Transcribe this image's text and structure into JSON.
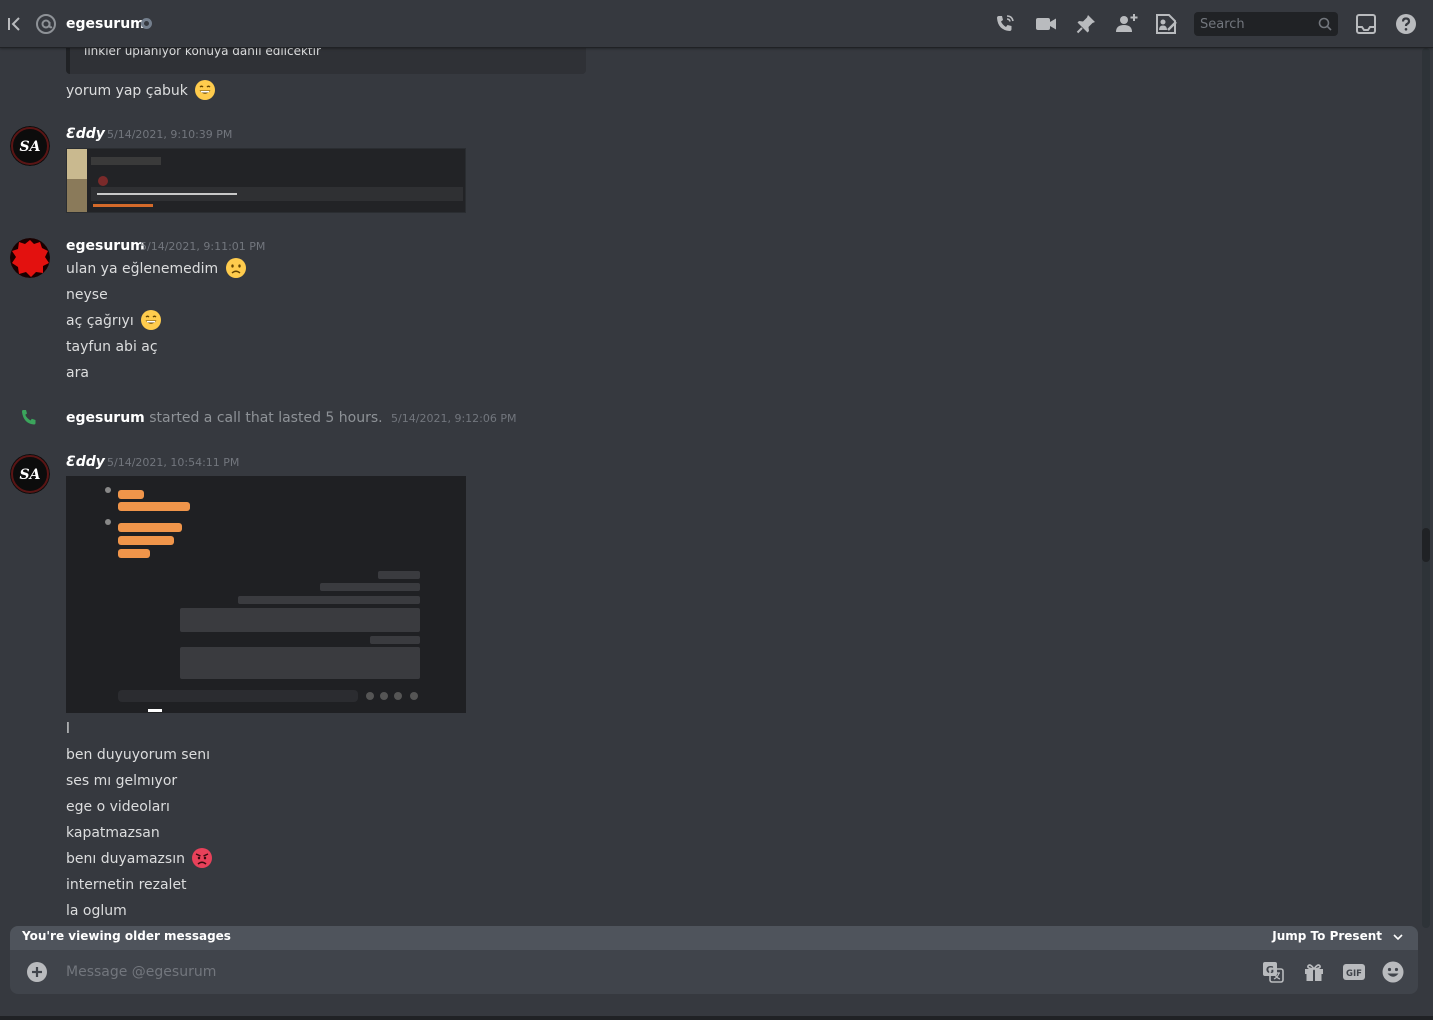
{
  "header": {
    "channel_name": "egesurum",
    "search_placeholder": "Search"
  },
  "messages": {
    "quote_text": "linkler upİanıyor konuya dahil edilcektir",
    "first_line": "yorum yap çabuk",
    "groups": [
      {
        "author": "Ɛddy",
        "time": "5/14/2021, 9:10:39 PM"
      },
      {
        "author": "egesurum",
        "time": "5/14/2021, 9:11:01 PM",
        "lines": [
          "ulan ya eğlenemedim",
          "neyse",
          "aç çağrıyı",
          "tayfun abi aç",
          "ara"
        ]
      },
      {
        "author": "Ɛddy",
        "time": "5/14/2021, 10:54:11 PM",
        "lines": [
          "l",
          "ben duyuyorum senı",
          "ses mı gelmıyor",
          "ege o videoları",
          "kapatmazsan",
          "benı duyamazsın",
          "internetin rezalet",
          "la oglum"
        ]
      }
    ],
    "call": {
      "user": "egesurum",
      "text": "started a call that lasted 5 hours.",
      "time": "5/14/2021, 9:12:06 PM"
    }
  },
  "older_bar": {
    "label": "You're viewing older messages",
    "jump_label": "Jump To Present"
  },
  "composer": {
    "placeholder": "Message @egesurum"
  },
  "colors": {
    "background": "#36393f",
    "composer": "#40444b",
    "older_bar": "#4f545c",
    "call_green": "#3ba55c",
    "emoji_yellow": "#ffcc4d",
    "emoji_angry": "#e8415a"
  }
}
